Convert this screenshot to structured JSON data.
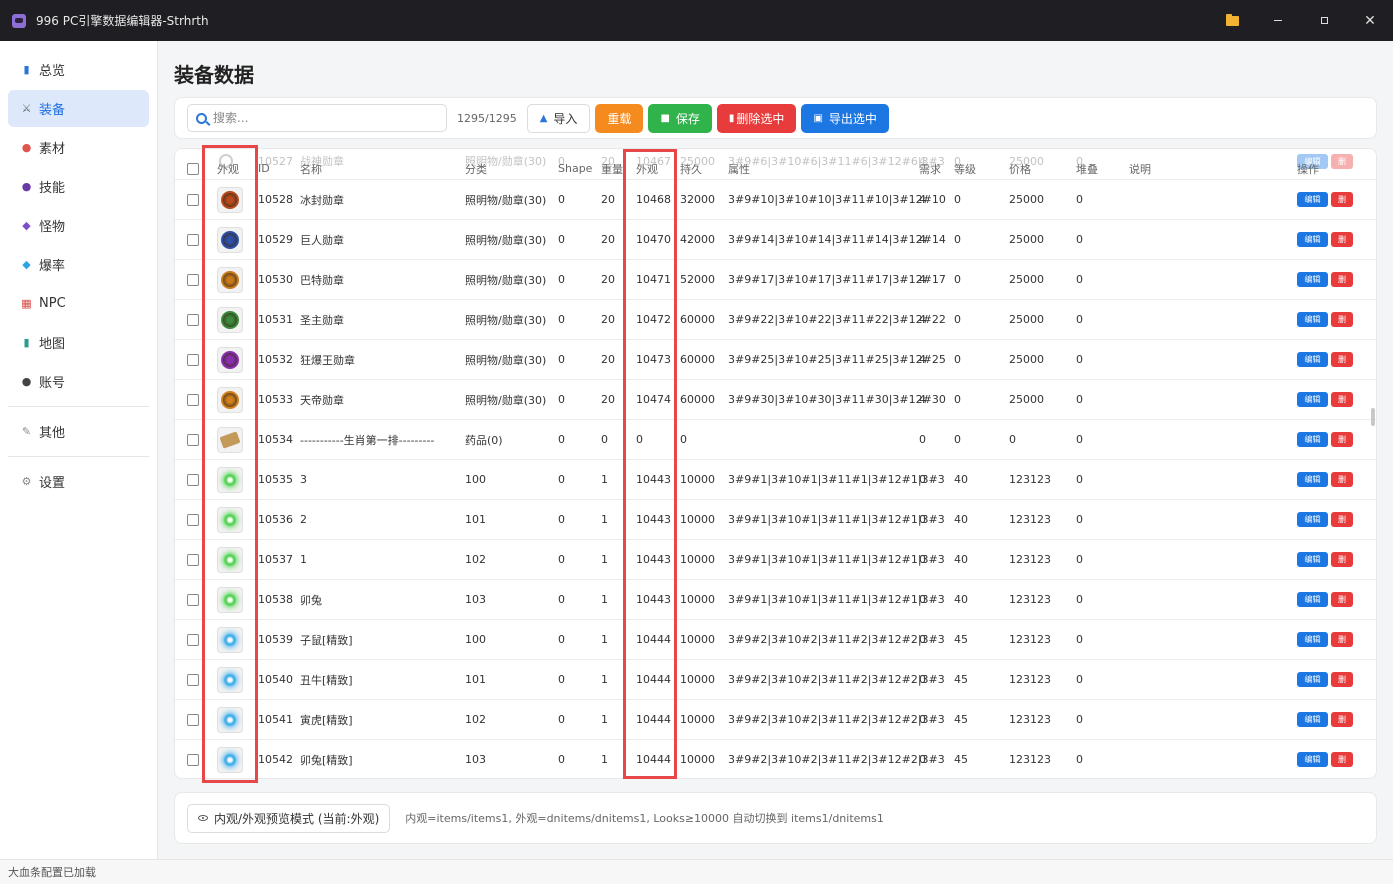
{
  "window": {
    "title": "996 PC引擎数据编辑器-Strhrth",
    "close_glyph": "✕"
  },
  "sidebar": {
    "items": [
      {
        "label": "总览",
        "icon": "bar-chart-icon",
        "glyph": "▮",
        "color": "#2a77d8"
      },
      {
        "label": "装备",
        "icon": "crossed-swords-icon",
        "glyph": "⚔",
        "color": "#666666",
        "active": true
      },
      {
        "label": "素材",
        "icon": "palette-icon",
        "glyph": "●",
        "color": "#e0554e"
      },
      {
        "label": "技能",
        "icon": "crystal-ball-icon",
        "glyph": "●",
        "color": "#6a3ba8"
      },
      {
        "label": "怪物",
        "icon": "monster-icon",
        "glyph": "◆",
        "color": "#7a4fc9"
      },
      {
        "label": "爆率",
        "icon": "gem-icon",
        "glyph": "◆",
        "color": "#2fa3e6"
      },
      {
        "label": "NPC",
        "icon": "shop-icon",
        "glyph": "▦",
        "color": "#d64848"
      },
      {
        "label": "地图",
        "icon": "map-icon",
        "glyph": "▮",
        "color": "#2a9d8f"
      },
      {
        "label": "账号",
        "icon": "user-icon",
        "glyph": "●",
        "color": "#444444"
      }
    ],
    "others": {
      "label": "其他",
      "icon": "wrench-icon",
      "glyph": "✎",
      "color": "#888888"
    },
    "settings": {
      "label": "设置",
      "icon": "gear-icon",
      "glyph": "⚙",
      "color": "#888888"
    }
  },
  "page": {
    "title": "装备数据"
  },
  "toolbar": {
    "search_placeholder": "搜索...",
    "count": "1295/1295",
    "import_label": "导入",
    "reload_label": "重载",
    "save_label": "保存",
    "delete_label": "删除选中",
    "export_label": "导出选中"
  },
  "table": {
    "columns": [
      "外观",
      "ID",
      "名称",
      "分类",
      "Shape",
      "重量",
      "外观",
      "持久",
      "属性",
      "需求",
      "等级",
      "价格",
      "堆叠",
      "说明",
      "操作"
    ],
    "edit_label": "编辑",
    "delete_label": "删",
    "ghost_row": {
      "id": "10527",
      "name": "战神勋章",
      "category": "照明物/勋章(30)",
      "shape": "0",
      "weight": "20",
      "looks": "10467",
      "durability": "25000",
      "attrs": "3#9#6|3#10#6|3#11#6|3#12#6|3#3",
      "need": "4",
      "level": "0",
      "price": "25000",
      "stack": "0"
    },
    "rows": [
      {
        "id": "10528",
        "name": "冰封勋章",
        "category": "照明物/勋章(30)",
        "shape": "0",
        "weight": "20",
        "looks": "10468",
        "durability": "32000",
        "attrs": "3#9#10|3#10#10|3#11#10|3#12#10",
        "need": "4",
        "level": "0",
        "price": "25000",
        "stack": "0",
        "thumb": "medal",
        "color": "#b84a1c"
      },
      {
        "id": "10529",
        "name": "巨人勋章",
        "category": "照明物/勋章(30)",
        "shape": "0",
        "weight": "20",
        "looks": "10470",
        "durability": "42000",
        "attrs": "3#9#14|3#10#14|3#11#14|3#12#14",
        "need": "4",
        "level": "0",
        "price": "25000",
        "stack": "0",
        "thumb": "medal",
        "color": "#2e4fa8"
      },
      {
        "id": "10530",
        "name": "巴特勋章",
        "category": "照明物/勋章(30)",
        "shape": "0",
        "weight": "20",
        "looks": "10471",
        "durability": "52000",
        "attrs": "3#9#17|3#10#17|3#11#17|3#12#17",
        "need": "4",
        "level": "0",
        "price": "25000",
        "stack": "0",
        "thumb": "medal",
        "color": "#c77a1a"
      },
      {
        "id": "10531",
        "name": "圣主勋章",
        "category": "照明物/勋章(30)",
        "shape": "0",
        "weight": "20",
        "looks": "10472",
        "durability": "60000",
        "attrs": "3#9#22|3#10#22|3#11#22|3#12#22",
        "need": "4",
        "level": "0",
        "price": "25000",
        "stack": "0",
        "thumb": "medal",
        "color": "#3a8a3a"
      },
      {
        "id": "10532",
        "name": "狂爆王勋章",
        "category": "照明物/勋章(30)",
        "shape": "0",
        "weight": "20",
        "looks": "10473",
        "durability": "60000",
        "attrs": "3#9#25|3#10#25|3#11#25|3#12#25",
        "need": "4",
        "level": "0",
        "price": "25000",
        "stack": "0",
        "thumb": "medal",
        "color": "#8a2fb0"
      },
      {
        "id": "10533",
        "name": "天帝勋章",
        "category": "照明物/勋章(30)",
        "shape": "0",
        "weight": "20",
        "looks": "10474",
        "durability": "60000",
        "attrs": "3#9#30|3#10#30|3#11#30|3#12#30",
        "need": "4",
        "level": "0",
        "price": "25000",
        "stack": "0",
        "thumb": "medal",
        "color": "#d0801c"
      },
      {
        "id": "10534",
        "name": "-----------生肖第一排---------",
        "category": "药品(0)",
        "shape": "0",
        "weight": "0",
        "looks": "0",
        "durability": "0",
        "attrs": "",
        "need": "0",
        "level": "0",
        "price": "0",
        "stack": "0",
        "thumb": "book",
        "color": "#c49a5a"
      },
      {
        "id": "10535",
        "name": "3",
        "category": "100",
        "shape": "0",
        "weight": "1",
        "looks": "10443",
        "durability": "10000",
        "attrs": "3#9#1|3#10#1|3#11#1|3#12#1|3#3",
        "need": "0",
        "level": "40",
        "price": "123123",
        "stack": "0",
        "thumb": "orb",
        "color": "#3fcf3f"
      },
      {
        "id": "10536",
        "name": "2",
        "category": "101",
        "shape": "0",
        "weight": "1",
        "looks": "10443",
        "durability": "10000",
        "attrs": "3#9#1|3#10#1|3#11#1|3#12#1|3#3",
        "need": "0",
        "level": "40",
        "price": "123123",
        "stack": "0",
        "thumb": "orb",
        "color": "#3fcf3f"
      },
      {
        "id": "10537",
        "name": "1",
        "category": "102",
        "shape": "0",
        "weight": "1",
        "looks": "10443",
        "durability": "10000",
        "attrs": "3#9#1|3#10#1|3#11#1|3#12#1|3#3",
        "need": "0",
        "level": "40",
        "price": "123123",
        "stack": "0",
        "thumb": "orb",
        "color": "#3fcf3f"
      },
      {
        "id": "10538",
        "name": "卯兔",
        "category": "103",
        "shape": "0",
        "weight": "1",
        "looks": "10443",
        "durability": "10000",
        "attrs": "3#9#1|3#10#1|3#11#1|3#12#1|3#3",
        "need": "0",
        "level": "40",
        "price": "123123",
        "stack": "0",
        "thumb": "orb",
        "color": "#3fcf3f"
      },
      {
        "id": "10539",
        "name": "子鼠[精致]",
        "category": "100",
        "shape": "0",
        "weight": "1",
        "looks": "10444",
        "durability": "10000",
        "attrs": "3#9#2|3#10#2|3#11#2|3#12#2|3#3",
        "need": "0",
        "level": "45",
        "price": "123123",
        "stack": "0",
        "thumb": "orb",
        "color": "#2aa6e8"
      },
      {
        "id": "10540",
        "name": "丑牛[精致]",
        "category": "101",
        "shape": "0",
        "weight": "1",
        "looks": "10444",
        "durability": "10000",
        "attrs": "3#9#2|3#10#2|3#11#2|3#12#2|3#3",
        "need": "0",
        "level": "45",
        "price": "123123",
        "stack": "0",
        "thumb": "orb",
        "color": "#2aa6e8"
      },
      {
        "id": "10541",
        "name": "寅虎[精致]",
        "category": "102",
        "shape": "0",
        "weight": "1",
        "looks": "10444",
        "durability": "10000",
        "attrs": "3#9#2|3#10#2|3#11#2|3#12#2|3#3",
        "need": "0",
        "level": "45",
        "price": "123123",
        "stack": "0",
        "thumb": "orb",
        "color": "#2aa6e8"
      },
      {
        "id": "10542",
        "name": "卯兔[精致]",
        "category": "103",
        "shape": "0",
        "weight": "1",
        "looks": "10444",
        "durability": "10000",
        "attrs": "3#9#2|3#10#2|3#11#2|3#12#2|3#3",
        "need": "0",
        "level": "45",
        "price": "123123",
        "stack": "0",
        "thumb": "orb",
        "color": "#2aa6e8"
      }
    ]
  },
  "bottom": {
    "mode_label": "内观/外观预览模式 (当前:外观)",
    "hint": "内观=items/items1, 外观=dnitems/dnitems1, Looks≥10000 自动切换到 items1/dnitems1"
  },
  "status": {
    "text": "大血条配置已加载"
  }
}
